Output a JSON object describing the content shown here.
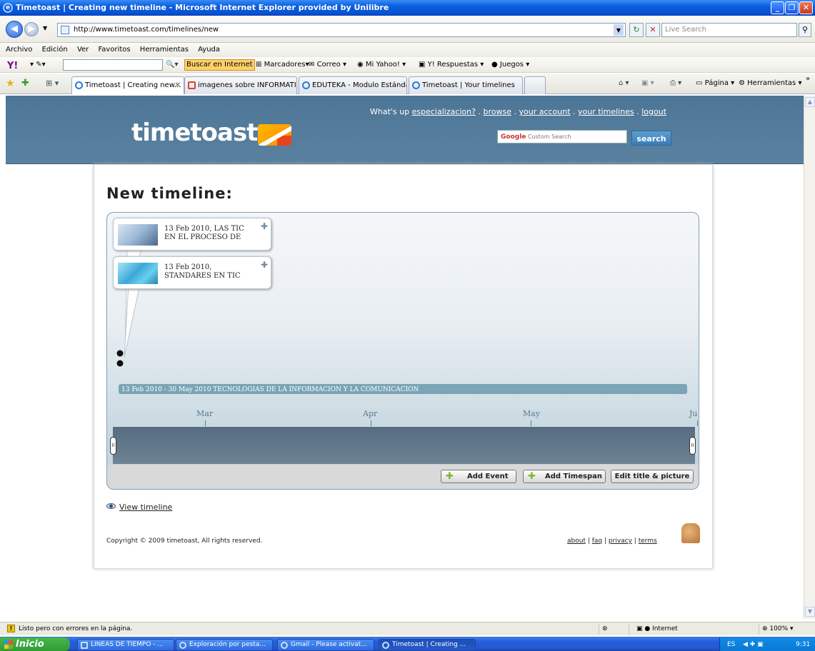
{
  "browser": {
    "title": "Timetoast | Creating new timeline - Microsoft Internet Explorer provided by Unilibre",
    "url": "http://www.timetoast.com/timelines/new",
    "live_search_placeholder": "Live Search",
    "menu": [
      "Archivo",
      "Edición",
      "Ver",
      "Favoritos",
      "Herramientas",
      "Ayuda"
    ],
    "yahoo": {
      "search_button": "Buscar en Internet",
      "items": [
        "Marcadores",
        "Correo",
        "Mi Yahoo!",
        "Y! Respuestas",
        "Juegos"
      ]
    },
    "tabs": [
      {
        "label": "Timetoast | Creating new..."
      },
      {
        "label": "imagenes sobre INFORMATI..."
      },
      {
        "label": "EDUTEKA - Modulo Estándar..."
      },
      {
        "label": "Timetoast | Your timelines"
      }
    ],
    "command_bar": {
      "page": "Página",
      "tools": "Herramientas"
    },
    "status": {
      "message": "Listo pero con errores en la página.",
      "zone": "Internet",
      "zoom": "100%"
    }
  },
  "site": {
    "logo_text": "timetoast",
    "greeting": "What's up",
    "username": "especializacion?",
    "nav": {
      "browse": "browse",
      "account": "your account",
      "timelines": "your timelines",
      "logout": "logout"
    },
    "search_placeholder_brand": "Google",
    "search_placeholder": "Custom Search",
    "search_button": "search"
  },
  "page": {
    "title": "New timeline:",
    "events": [
      {
        "text": "13 Feb 2010, LAS TIC EN EL PROCESO DE"
      },
      {
        "text": "13 Feb 2010, STANDARES EN TIC"
      }
    ],
    "timespan": "13 Feb 2010 - 30 May 2010  TECNOLOGIAS DE LA INFORMACION Y LA COMUNICACION",
    "months": [
      "Mar",
      "Apr",
      "May",
      "Ju"
    ],
    "buttons": {
      "add_event": "Add Event",
      "add_timespan": "Add Timespan",
      "edit_title": "Edit title & picture"
    },
    "view_timeline": "View timeline",
    "copyright": "Copyright © 2009 timetoast, All rights reserved.",
    "footer": {
      "about": "about",
      "faq": "faq",
      "privacy": "privacy",
      "terms": "terms"
    }
  },
  "taskbar": {
    "start": "Inicio",
    "items": [
      "LINEAS DE TIEMPO - ...",
      "Exploración por pesta...",
      "Gmail - Please activat...",
      "Timetoast | Creating ..."
    ],
    "lang": "ES",
    "clock": "9:31"
  }
}
